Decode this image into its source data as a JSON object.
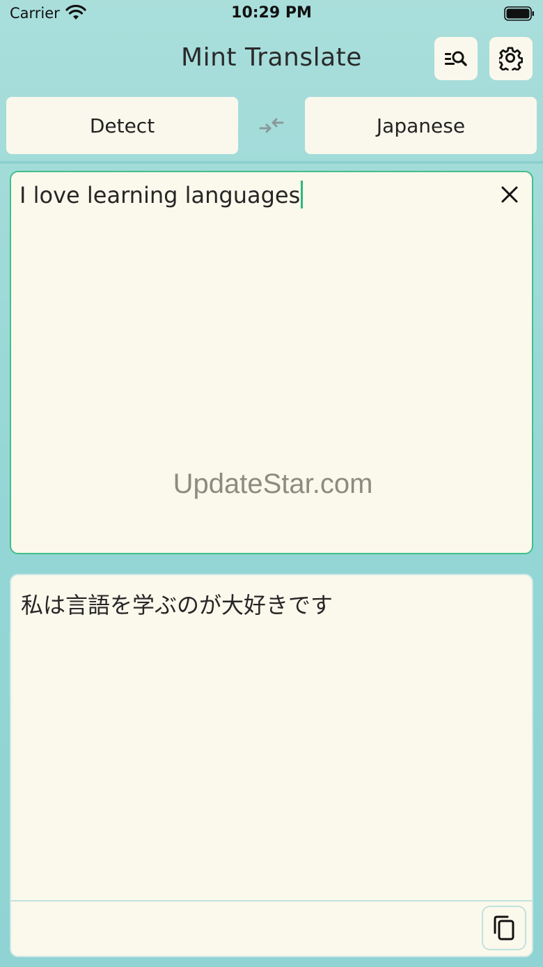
{
  "status": {
    "carrier": "Carrier",
    "time": "10:29 PM"
  },
  "header": {
    "title": "Mint Translate",
    "history_icon": "search-list-icon",
    "settings_icon": "gear-icon"
  },
  "languages": {
    "source": "Detect",
    "target": "Japanese",
    "swap_icon": "swap-arrows-icon"
  },
  "input": {
    "text": "I love learning languages",
    "clear_icon": "close-icon",
    "accent": "#3fbf8a"
  },
  "watermark": "UpdateStar.com",
  "output": {
    "text": "私は言語を学ぶのが大好きです",
    "copy_icon": "copy-icon"
  },
  "colors": {
    "background": "#a9dedb",
    "card": "#fbf8ec"
  }
}
